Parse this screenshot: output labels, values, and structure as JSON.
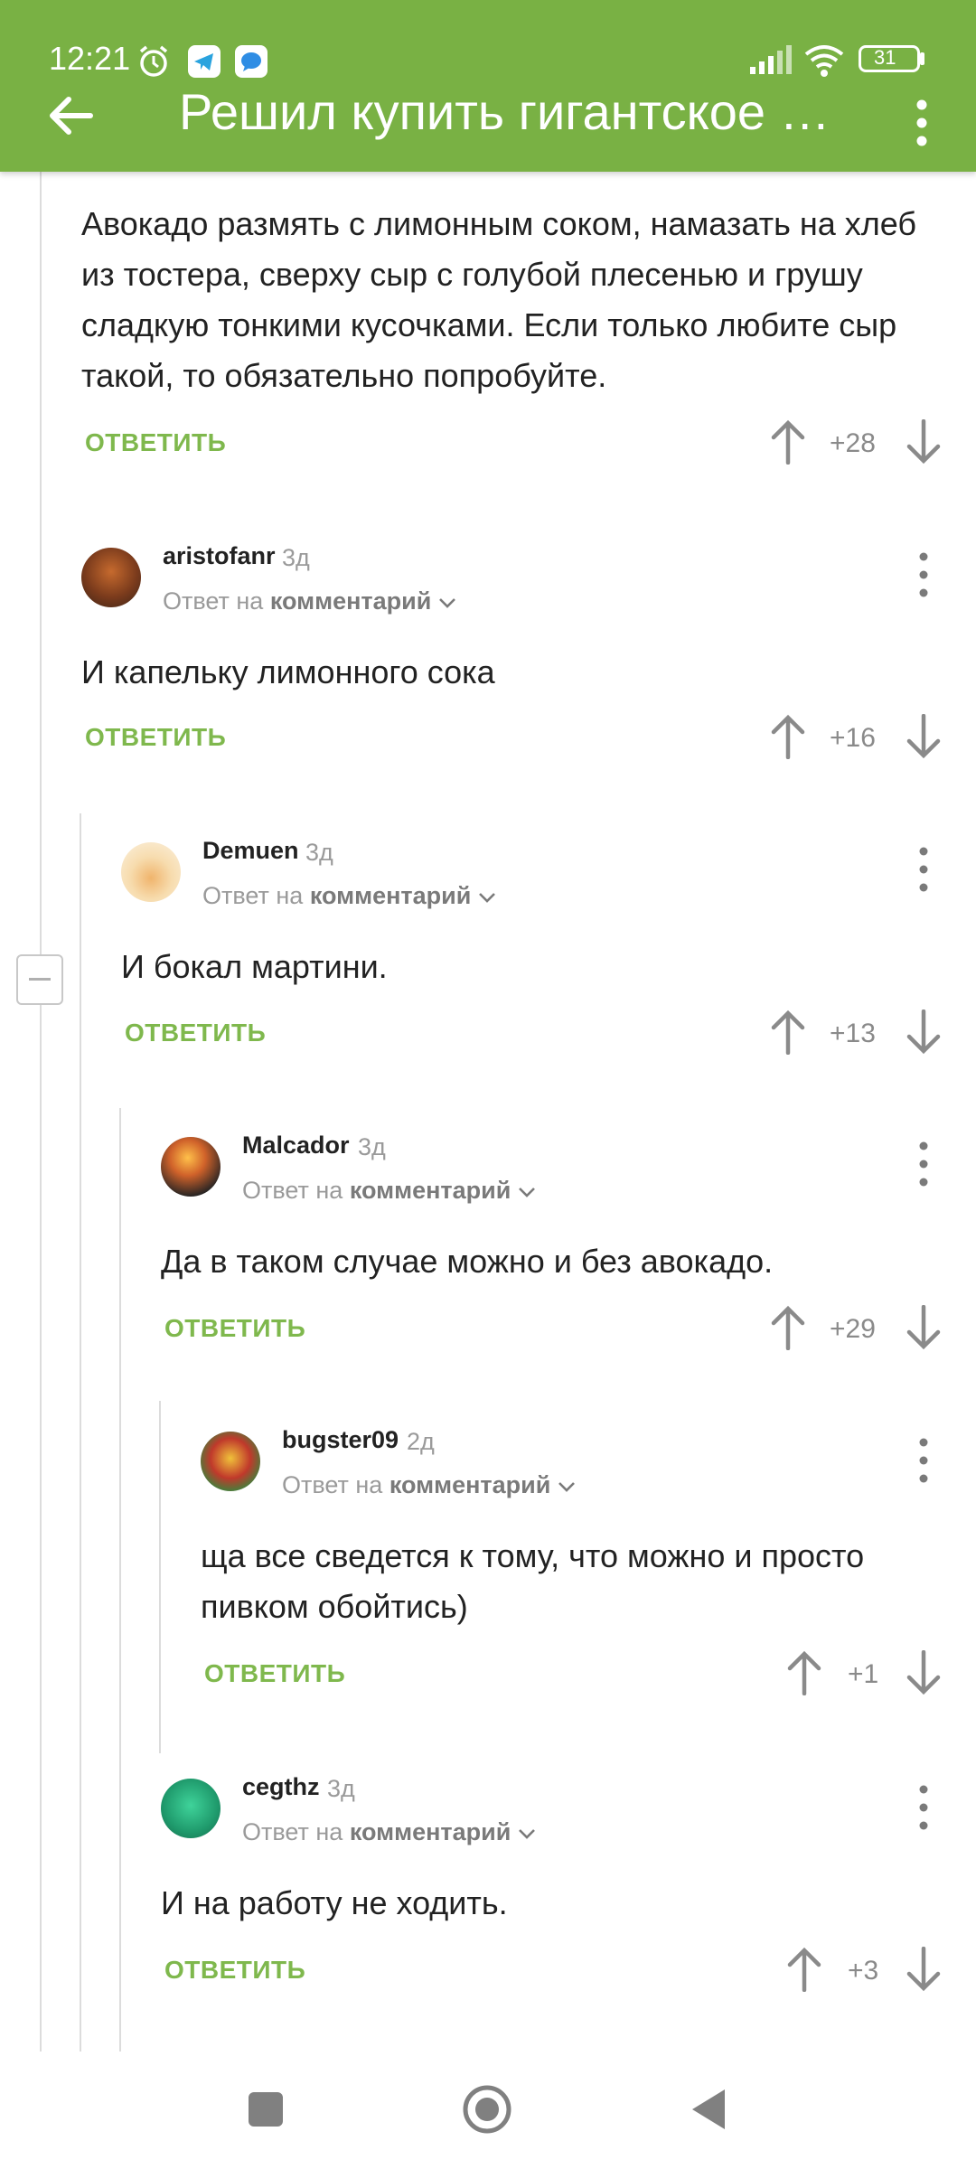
{
  "status_bar": {
    "time": "12:21",
    "battery": "31"
  },
  "header": {
    "title": "Решил купить гигантское а..."
  },
  "top_comment": {
    "text": "Авокадо размять с лимонным соком, намазать на хлеб из тостера, сверху сыр с голубой плесенью и грушу сладкую тонкими кусочками. Если только любите сыр такой, то обязательно попробуйте.",
    "reply_label": "ОТВЕТИТЬ",
    "score": "+28"
  },
  "comments": [
    {
      "author": "aristofanr",
      "age": "3д",
      "reply_to_prefix": "Ответ на",
      "reply_to_link": "комментарий",
      "text": "И капельку лимонного сока",
      "reply_label": "ОТВЕТИТЬ",
      "score": "+16"
    },
    {
      "author": "Demuen",
      "age": "3д",
      "reply_to_prefix": "Ответ на",
      "reply_to_link": "комментарий",
      "text": "И бокал мартини.",
      "reply_label": "ОТВЕТИТЬ",
      "score": "+13"
    },
    {
      "author": "Malcador",
      "age": "3д",
      "reply_to_prefix": "Ответ на",
      "reply_to_link": "комментарий",
      "text": "Да в таком случае можно и без авокадо.",
      "reply_label": "ОТВЕТИТЬ",
      "score": "+29"
    },
    {
      "author": "bugster09",
      "age": "2д",
      "reply_to_prefix": "Ответ на",
      "reply_to_link": "комментарий",
      "text": "ща все сведется к тому, что можно и просто пивком обойтись)",
      "reply_label": "ОТВЕТИТЬ",
      "score": "+1"
    },
    {
      "author": "cegthz",
      "age": "3д",
      "reply_to_prefix": "Ответ на",
      "reply_to_link": "комментарий",
      "text": "И на работу не ходить.",
      "reply_label": "ОТВЕТИТЬ",
      "score": "+3"
    }
  ],
  "colors": {
    "accent": "#79b144",
    "reply": "#7fb84d",
    "muted": "#9a9a9a"
  },
  "icons": [
    "alarm-icon",
    "telegram-icon",
    "messenger-icon",
    "signal-icon",
    "wifi-icon",
    "battery-icon",
    "back-arrow-icon",
    "more-vert-icon",
    "upvote-icon",
    "downvote-icon",
    "collapse-icon",
    "nav-square-icon",
    "nav-home-icon",
    "nav-back-icon"
  ]
}
